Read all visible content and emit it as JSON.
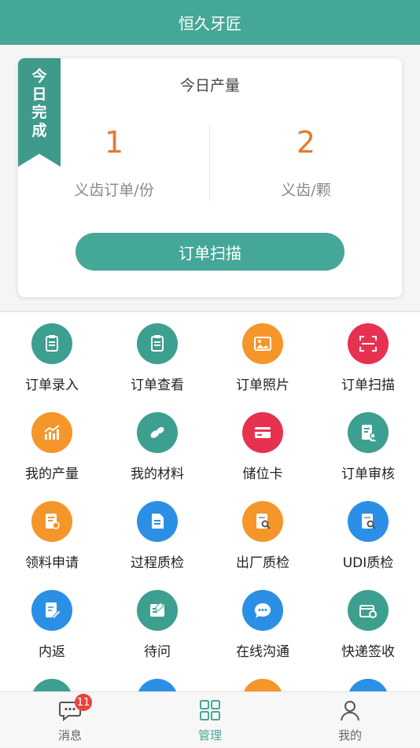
{
  "header": {
    "title": "恒久牙匠"
  },
  "card": {
    "ribbon_text": [
      "今",
      "日",
      "完",
      "成"
    ],
    "title": "今日产量",
    "stats": [
      {
        "value": "1",
        "label": "义齿订单/份"
      },
      {
        "value": "2",
        "label": "义齿/颗"
      }
    ],
    "scan_button": "订单扫描"
  },
  "grid": [
    {
      "label": "订单录入",
      "icon": "clipboard-icon",
      "color": "#3d9f8f"
    },
    {
      "label": "订单查看",
      "icon": "clipboard-icon",
      "color": "#3d9f8f"
    },
    {
      "label": "订单照片",
      "icon": "image-icon",
      "color": "#f5962a"
    },
    {
      "label": "订单扫描",
      "icon": "scan-icon",
      "color": "#e63250"
    },
    {
      "label": "我的产量",
      "icon": "chart-icon",
      "color": "#f5962a"
    },
    {
      "label": "我的材料",
      "icon": "pills-icon",
      "color": "#3d9f8f"
    },
    {
      "label": "储位卡",
      "icon": "card-icon",
      "color": "#e63250"
    },
    {
      "label": "订单审核",
      "icon": "review-icon",
      "color": "#3d9f8f"
    },
    {
      "label": "领料申请",
      "icon": "edit-doc-icon",
      "color": "#f5962a"
    },
    {
      "label": "过程质检",
      "icon": "document-icon",
      "color": "#2b8fe6"
    },
    {
      "label": "出厂质检",
      "icon": "search-doc-icon",
      "color": "#f5962a"
    },
    {
      "label": "UDI质检",
      "icon": "search-doc-icon",
      "color": "#2b8fe6"
    },
    {
      "label": "内返",
      "icon": "pen-doc-icon",
      "color": "#2b8fe6"
    },
    {
      "label": "待问",
      "icon": "note-icon",
      "color": "#3d9f8f"
    },
    {
      "label": "在线沟通",
      "icon": "chat-icon",
      "color": "#2b8fe6"
    },
    {
      "label": "快递签收",
      "icon": "package-icon",
      "color": "#3d9f8f"
    },
    {
      "label": "",
      "icon": "partial-icon",
      "color": "#3d9f8f"
    },
    {
      "label": "",
      "icon": "partial-icon",
      "color": "#2b8fe6"
    },
    {
      "label": "",
      "icon": "partial-icon",
      "color": "#f5962a"
    },
    {
      "label": "",
      "icon": "partial-icon",
      "color": "#2b8fe6"
    }
  ],
  "tabbar": [
    {
      "label": "消息",
      "icon": "message-icon",
      "badge": "11"
    },
    {
      "label": "管理",
      "icon": "grid-icon",
      "badge": ""
    },
    {
      "label": "我的",
      "icon": "user-icon",
      "badge": ""
    }
  ],
  "colors": {
    "brand": "#45a797",
    "stat_number": "#e8792a",
    "badge": "#e8453c"
  }
}
